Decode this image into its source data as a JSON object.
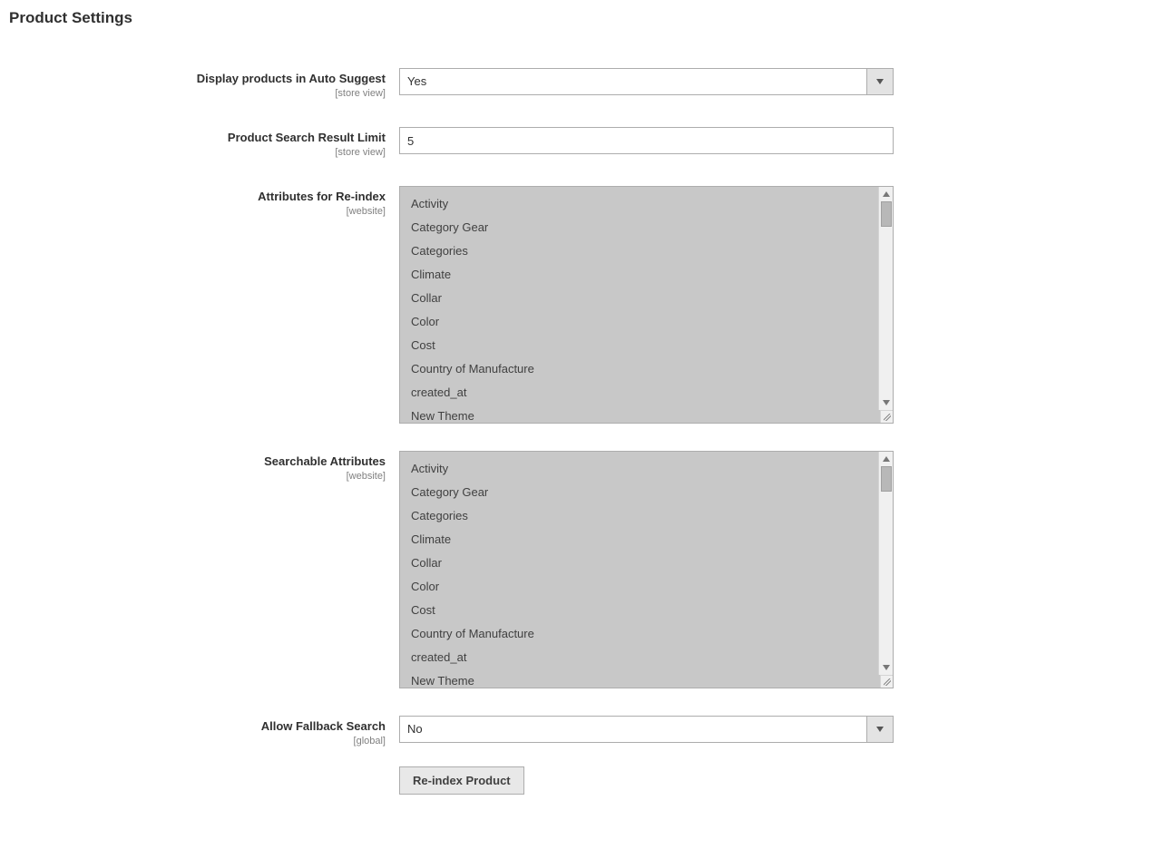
{
  "section_title": "Product Settings",
  "fields": {
    "display_products": {
      "label": "Display products in Auto Suggest",
      "scope": "[store view]",
      "value": "Yes"
    },
    "result_limit": {
      "label": "Product Search Result Limit",
      "scope": "[store view]",
      "value": "5"
    },
    "reindex_attrs": {
      "label": "Attributes for Re-index",
      "scope": "[website]",
      "options": [
        "Activity",
        "Category Gear",
        "Categories",
        "Climate",
        "Collar",
        "Color",
        "Cost",
        "Country of Manufacture",
        "created_at",
        "New Theme"
      ]
    },
    "searchable_attrs": {
      "label": "Searchable Attributes",
      "scope": "[website]",
      "options": [
        "Activity",
        "Category Gear",
        "Categories",
        "Climate",
        "Collar",
        "Color",
        "Cost",
        "Country of Manufacture",
        "created_at",
        "New Theme"
      ]
    },
    "fallback": {
      "label": "Allow Fallback Search",
      "scope": "[global]",
      "value": "No"
    }
  },
  "actions": {
    "reindex_button": "Re-index Product"
  }
}
